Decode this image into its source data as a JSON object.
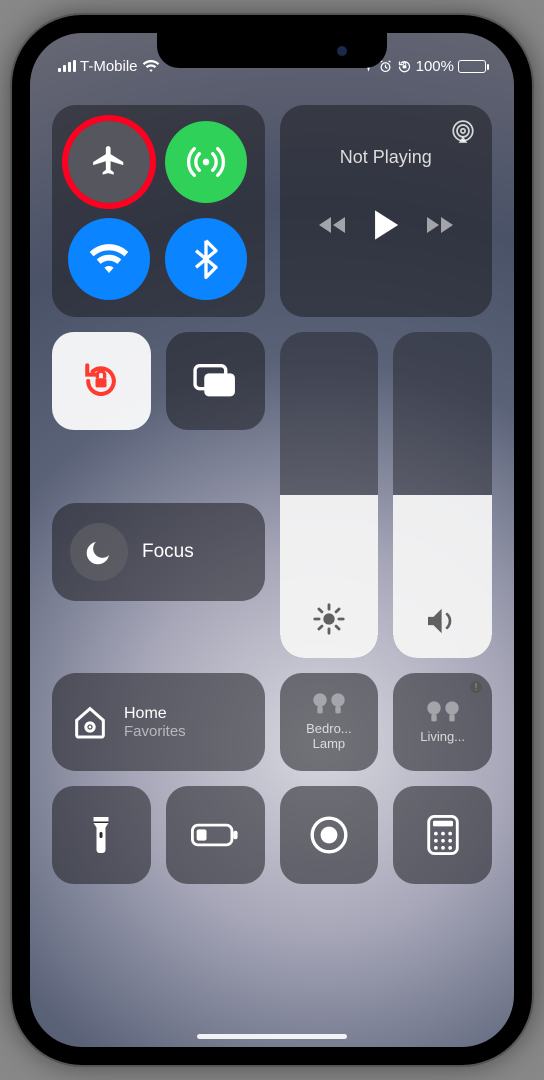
{
  "status": {
    "carrier": "T-Mobile",
    "battery_pct": "100%",
    "battery_fill_pct": 100
  },
  "connectivity": {
    "airplane": {
      "name": "airplane-mode",
      "active": false,
      "highlighted": true
    },
    "cellular": {
      "name": "cellular-data",
      "active": true
    },
    "wifi": {
      "name": "wifi",
      "active": true
    },
    "bluetooth": {
      "name": "bluetooth",
      "active": true
    }
  },
  "media": {
    "title": "Not Playing",
    "airplay_label": "airplay"
  },
  "rotation_lock": {
    "active": true
  },
  "screen_mirroring": {
    "label": "screen-mirroring"
  },
  "focus": {
    "label": "Focus"
  },
  "sliders": {
    "brightness": {
      "fill_pct": 50
    },
    "volume": {
      "fill_pct": 50
    }
  },
  "home": {
    "title": "Home",
    "subtitle": "Favorites",
    "accessories": [
      {
        "name": "bedroom-lamp",
        "label": "Bedro...\nLamp"
      },
      {
        "name": "living-room",
        "label": "Living...",
        "warning": true
      }
    ]
  },
  "bottom_row": {
    "flashlight": "flashlight",
    "low_power": "low-power-mode",
    "screen_record": "screen-recording",
    "calculator": "calculator"
  }
}
